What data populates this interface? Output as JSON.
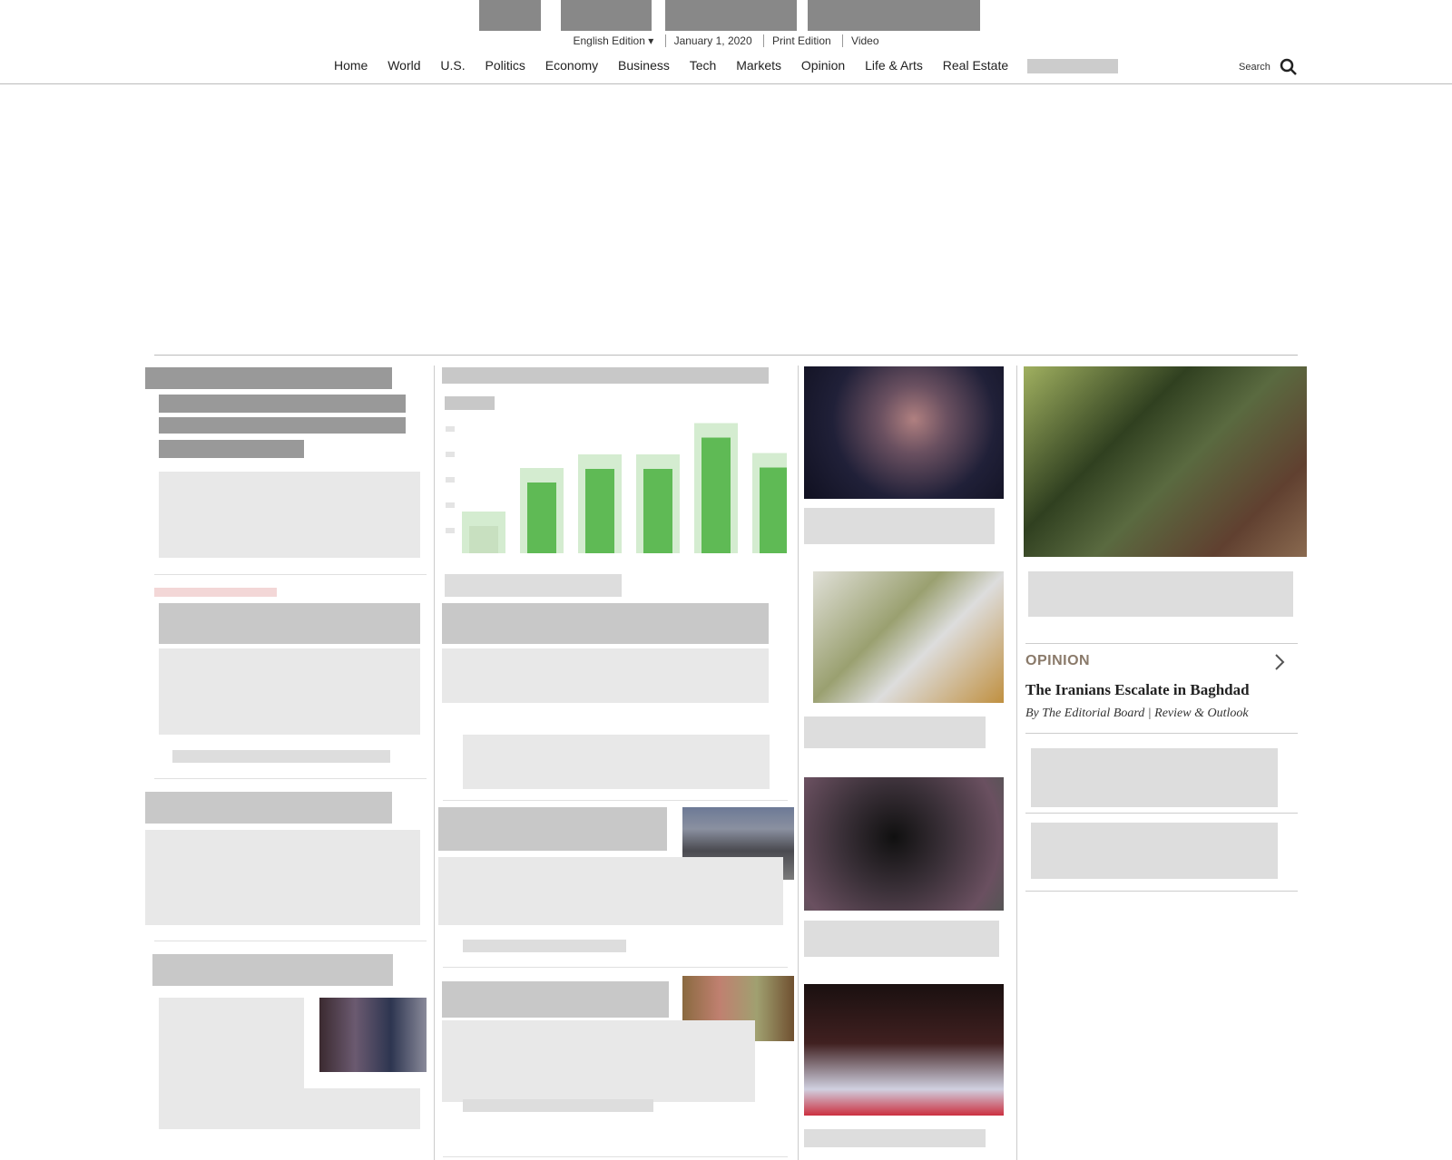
{
  "edition_bar": [
    "English Edition ▾",
    "January 1, 2020",
    "Print Edition",
    "Video"
  ],
  "nav": [
    "Home",
    "World",
    "U.S.",
    "Politics",
    "Economy",
    "Business",
    "Tech",
    "Markets",
    "Opinion",
    "Life & Arts",
    "Real Estate"
  ],
  "search_label": "Search",
  "opinion": {
    "label": "OPINION",
    "headline": "The Iranians Escalate in Baghdad",
    "byline": "By The Editorial Board | Review & Outlook"
  },
  "chart_data": {
    "type": "bar",
    "bars": [
      0.2,
      0.52,
      0.62,
      0.62,
      0.85,
      0.63
    ]
  }
}
